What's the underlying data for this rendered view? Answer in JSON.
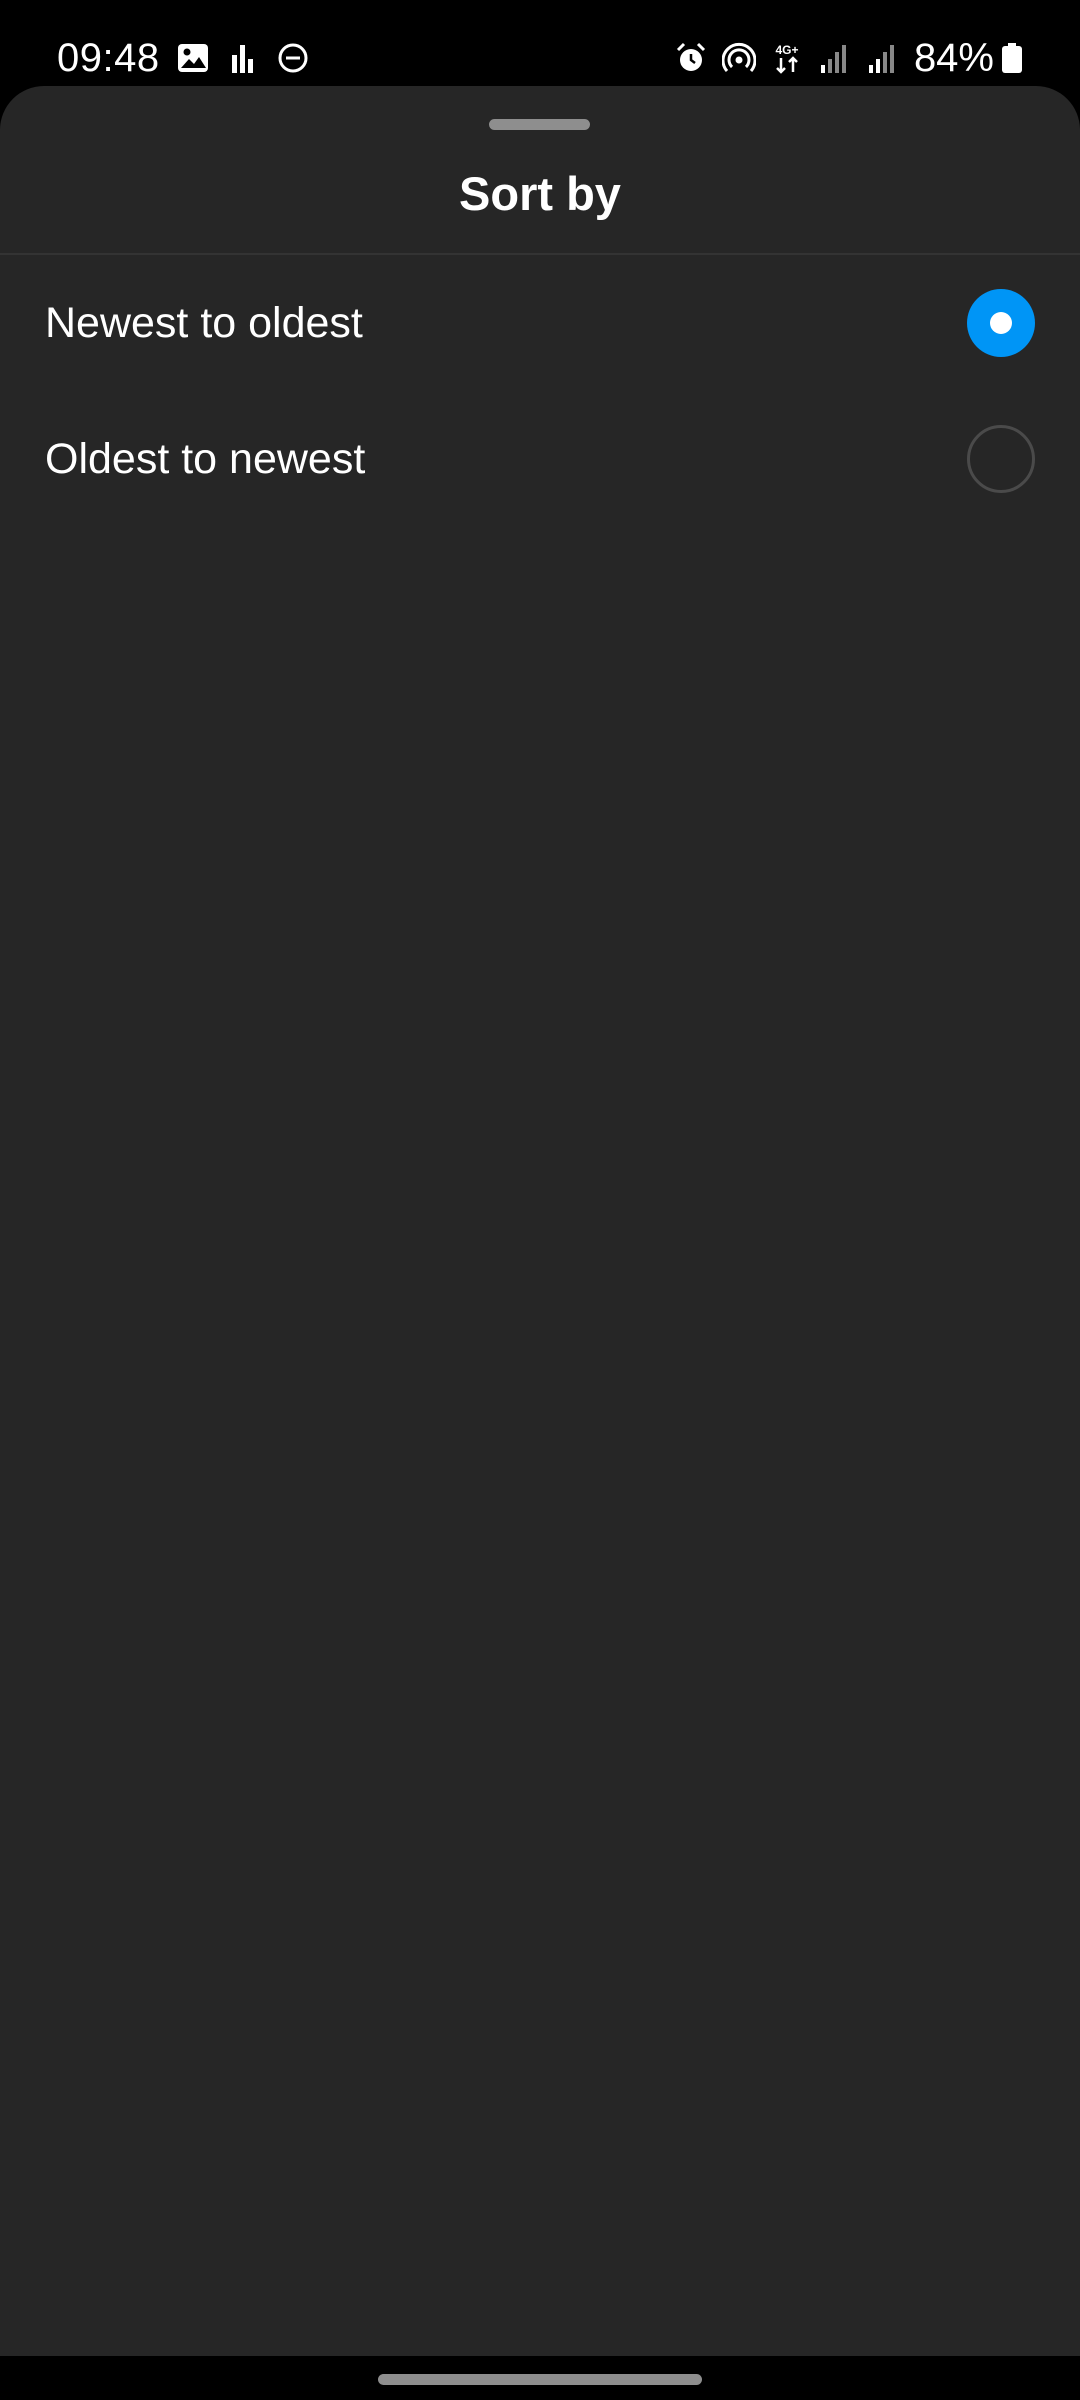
{
  "status_bar": {
    "time": "09:48",
    "battery_percent": "84%",
    "network_label": "4G+",
    "left_icons": [
      "image-icon",
      "bar-chart-icon",
      "do-not-disturb-icon"
    ],
    "right_icons": [
      "alarm-icon",
      "hotspot-icon",
      "mobile-data-icon",
      "signal-icon",
      "signal-icon",
      "battery-icon"
    ]
  },
  "sheet": {
    "title": "Sort by",
    "options": [
      {
        "label": "Newest to oldest",
        "selected": true
      },
      {
        "label": "Oldest to newest",
        "selected": false
      }
    ]
  },
  "colors": {
    "sheet_background": "#262626",
    "accent": "#0095f6"
  }
}
